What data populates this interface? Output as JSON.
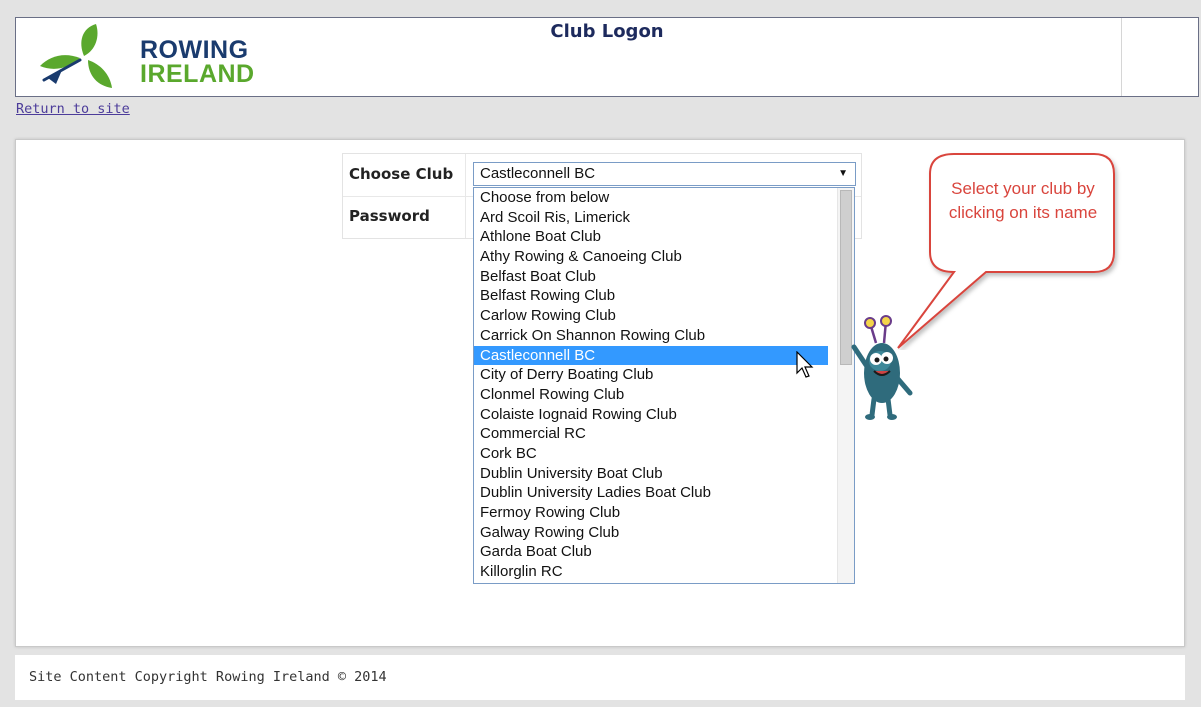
{
  "header": {
    "logo": {
      "line1": "ROWING",
      "line2": "IRELAND"
    },
    "title": "Club Logon"
  },
  "nav": {
    "return_link": "Return to site"
  },
  "form": {
    "club_label": "Choose Club",
    "password_label": "Password",
    "selected_club": "Castleconnell BC",
    "club_options": [
      "Choose from below",
      "Ard Scoil Ris, Limerick",
      "Athlone Boat Club",
      "Athy Rowing & Canoeing Club",
      "Belfast Boat Club",
      "Belfast Rowing Club",
      "Carlow Rowing Club",
      "Carrick On Shannon Rowing Club",
      "Castleconnell BC",
      "City of Derry Boating Club",
      "Clonmel Rowing Club",
      "Colaiste Iognaid Rowing Club",
      "Commercial RC",
      "Cork BC",
      "Dublin University Boat Club",
      "Dublin University Ladies Boat Club",
      "Fermoy Rowing Club",
      "Galway Rowing Club",
      "Garda Boat Club",
      "Killorglin RC"
    ],
    "highlighted_index": 8
  },
  "callout": {
    "text": "Select your club by clicking on its name"
  },
  "footer": {
    "copyright": "Site Content Copyright Rowing Ireland © 2014"
  },
  "colors": {
    "logo_navy": "#1a3b6e",
    "logo_green": "#5aa82d",
    "link_purple": "#4c3c9a",
    "selection_blue": "#3399ff",
    "callout_red": "#d9453d"
  }
}
